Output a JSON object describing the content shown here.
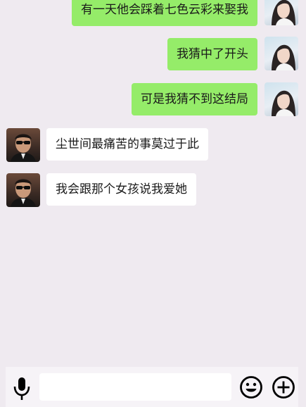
{
  "messages": [
    {
      "side": "right",
      "text": "有一天他会踩着七色云彩来娶我",
      "avatar": "girl-avatar"
    },
    {
      "side": "right",
      "text": "我猜中了开头",
      "avatar": "girl-avatar"
    },
    {
      "side": "right",
      "text": "可是我猜不到这结局",
      "avatar": "girl-avatar"
    },
    {
      "side": "left",
      "text": "尘世间最痛苦的事莫过于此",
      "avatar": "guy-avatar"
    },
    {
      "side": "left",
      "text": "我会跟那个女孩说我爱她",
      "avatar": "guy-avatar"
    }
  ],
  "input": {
    "value": "",
    "placeholder": ""
  },
  "icons": {
    "voice": "microphone-icon",
    "emoji": "smiley-icon",
    "more": "plus-circle-icon"
  },
  "colors": {
    "outgoing_bubble": "#95ec69",
    "incoming_bubble": "#ffffff",
    "background": "#efeaf0"
  }
}
